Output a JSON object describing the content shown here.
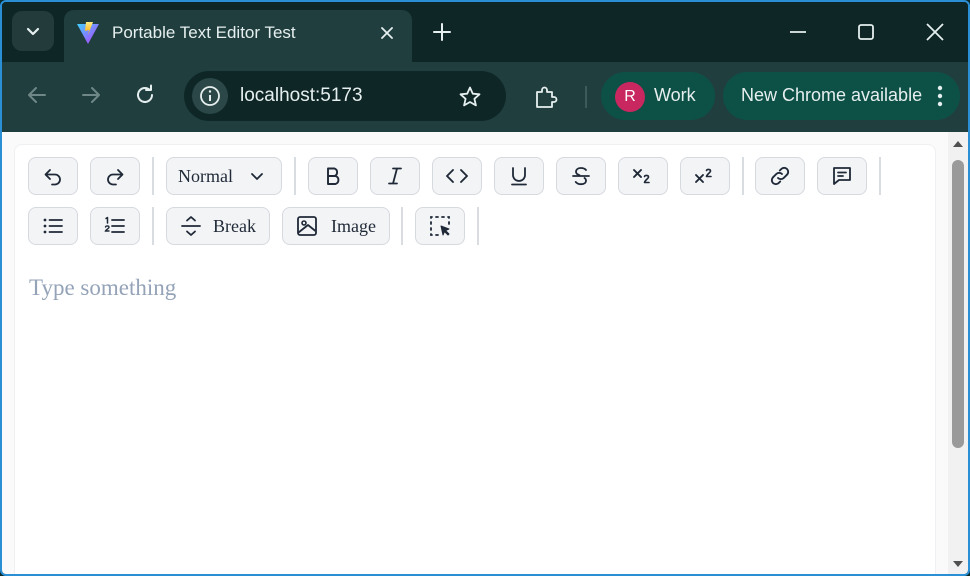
{
  "browser": {
    "tab": {
      "title": "Portable Text Editor Test",
      "favicon": "vite-logo-icon"
    },
    "address": {
      "url": "localhost:5173"
    },
    "profile": {
      "initial": "R",
      "label": "Work",
      "avatar_color": "#c8285f"
    },
    "update_label": "New Chrome available",
    "colors": {
      "frame": "#0e2626",
      "toolbar": "#203e3e",
      "pill": "#0d5046",
      "border": "#2b8fd6"
    }
  },
  "editor": {
    "toolbar_row1": [
      {
        "name": "undo-button",
        "icon": "undo-icon"
      },
      {
        "name": "redo-button",
        "icon": "redo-icon"
      },
      {
        "name": "style-select",
        "label": "Normal",
        "icon": "chevron-down-icon"
      },
      {
        "name": "bold-button",
        "icon": "bold-icon"
      },
      {
        "name": "italic-button",
        "icon": "italic-icon"
      },
      {
        "name": "code-button",
        "icon": "code-icon"
      },
      {
        "name": "underline-button",
        "icon": "underline-icon"
      },
      {
        "name": "strikethrough-button",
        "icon": "strikethrough-icon"
      },
      {
        "name": "subscript-button",
        "icon": "subscript-icon"
      },
      {
        "name": "superscript-button",
        "icon": "superscript-icon"
      },
      {
        "name": "link-button",
        "icon": "link-icon"
      },
      {
        "name": "comment-button",
        "icon": "comment-icon"
      }
    ],
    "toolbar_row2": [
      {
        "name": "bullet-list-button",
        "icon": "bullet-list-icon"
      },
      {
        "name": "numbered-list-button",
        "icon": "numbered-list-icon"
      },
      {
        "name": "break-button",
        "label": "Break",
        "icon": "break-icon"
      },
      {
        "name": "image-button",
        "label": "Image",
        "icon": "image-icon"
      },
      {
        "name": "select-button",
        "icon": "selection-icon"
      }
    ],
    "style_label": "Normal",
    "break_label": "Break",
    "image_label": "Image",
    "placeholder": "Type something"
  }
}
